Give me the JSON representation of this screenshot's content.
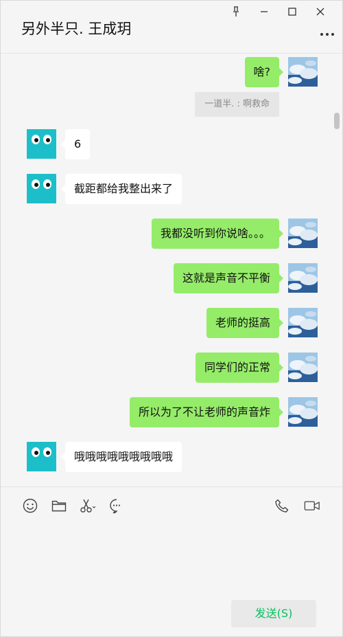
{
  "header": {
    "title": "另外半只. 王成玥",
    "controls": [
      "pin-icon",
      "minimize-icon",
      "maximize-icon",
      "close-icon"
    ],
    "more_icon": "more-icon"
  },
  "messages": [
    {
      "side": "me",
      "text": "啥?"
    },
    {
      "side": "system",
      "text": "一道半. : 啊救命"
    },
    {
      "side": "other",
      "text": "6"
    },
    {
      "side": "other",
      "text": "截距都给我整出来了"
    },
    {
      "side": "me",
      "text": "我都没听到你说啥。。。"
    },
    {
      "side": "me",
      "text": "这就是声音不平衡"
    },
    {
      "side": "me",
      "text": "老师的挺高"
    },
    {
      "side": "me",
      "text": "同学们的正常"
    },
    {
      "side": "me",
      "text": "所以为了不让老师的声音炸"
    },
    {
      "side": "other",
      "text": "哦哦哦哦哦哦哦哦哦"
    }
  ],
  "toolbar": {
    "left": [
      "emoji-icon",
      "folder-icon",
      "scissors-icon",
      "chat-history-icon"
    ],
    "right": [
      "phone-icon",
      "video-icon"
    ]
  },
  "input": {
    "value": ""
  },
  "send_button": {
    "label": "发送(S)"
  },
  "colors": {
    "me_bubble": "#95ec69",
    "other_bubble": "#ffffff",
    "send_text": "#07c160",
    "background": "#f5f5f5"
  }
}
